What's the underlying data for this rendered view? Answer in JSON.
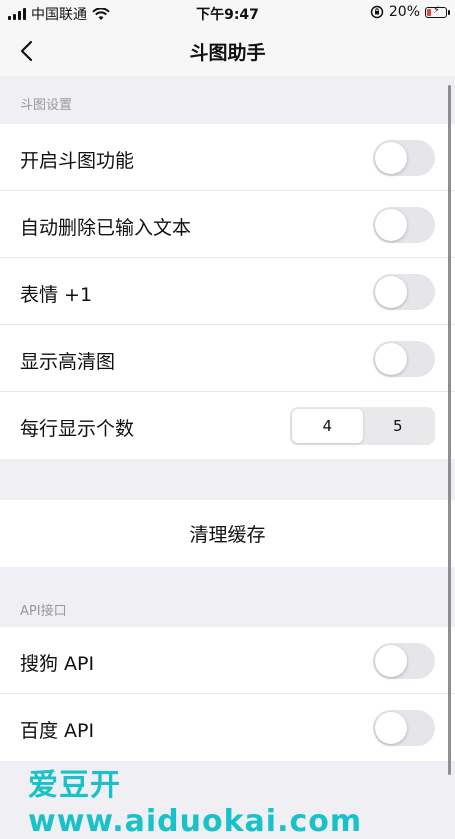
{
  "status_bar": {
    "carrier": "中国联通",
    "time": "下午9:47",
    "battery": "20%"
  },
  "nav": {
    "title": "斗图助手"
  },
  "sections": {
    "settings_header": "斗图设置",
    "api_header": "API接口"
  },
  "settings": {
    "enable_label": "开启斗图功能",
    "enable_on": false,
    "auto_delete_label": "自动删除已输入文本",
    "auto_delete_on": false,
    "emoji_plus_label": "表情 +1",
    "emoji_plus_on": false,
    "hd_label": "显示高清图",
    "hd_on": false,
    "per_row_label": "每行显示个数",
    "per_row_options": [
      "4",
      "5"
    ],
    "per_row_selected": "4"
  },
  "clear_cache_label": "清理缓存",
  "api": {
    "sogou_label": "搜狗 API",
    "sogou_on": false,
    "baidu_label": "百度 API",
    "baidu_on": false
  },
  "watermark": "爱豆开www.aiduokai.com",
  "colors": {
    "background": "#efeff4",
    "toggle_off": "#e5e5ea",
    "watermark": "#18c2c8",
    "battery_low": "#e5453a"
  }
}
